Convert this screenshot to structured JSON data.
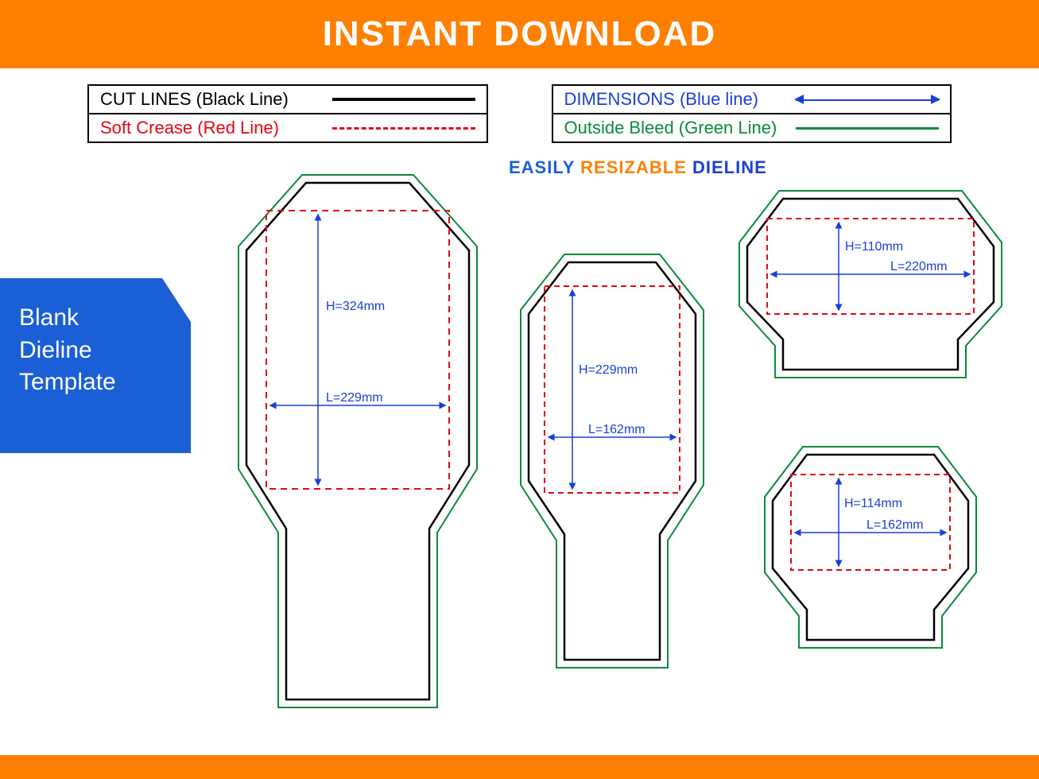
{
  "header": {
    "title": "INSTANT DOWNLOAD"
  },
  "legend": {
    "left": [
      {
        "label": "CUT LINES (Black Line)",
        "color": "black"
      },
      {
        "label": "Soft Crease (Red Line)",
        "color": "red"
      }
    ],
    "right": [
      {
        "label": "DIMENSIONS (Blue line)",
        "color": "blue"
      },
      {
        "label": "Outside Bleed (Green Line)",
        "color": "green"
      }
    ]
  },
  "tagline": {
    "w1": "EASILY",
    "w2": "RESIZABLE",
    "w3": "DIELINE"
  },
  "sidebar": {
    "line1": "Blank",
    "line2": "Dieline",
    "line3": "Template"
  },
  "shapes": [
    {
      "id": "shape-a",
      "H": "H=324mm",
      "L": "L=229mm"
    },
    {
      "id": "shape-b",
      "H": "H=229mm",
      "L": "L=162mm"
    },
    {
      "id": "shape-c",
      "H": "H=110mm",
      "L": "L=220mm"
    },
    {
      "id": "shape-d",
      "H": "H=114mm",
      "L": "L=162mm"
    }
  ],
  "colors": {
    "orange": "#ff7f00",
    "blue": "#1a3fd6",
    "red": "#e30613",
    "green": "#0a8a3a",
    "black": "#000000"
  }
}
